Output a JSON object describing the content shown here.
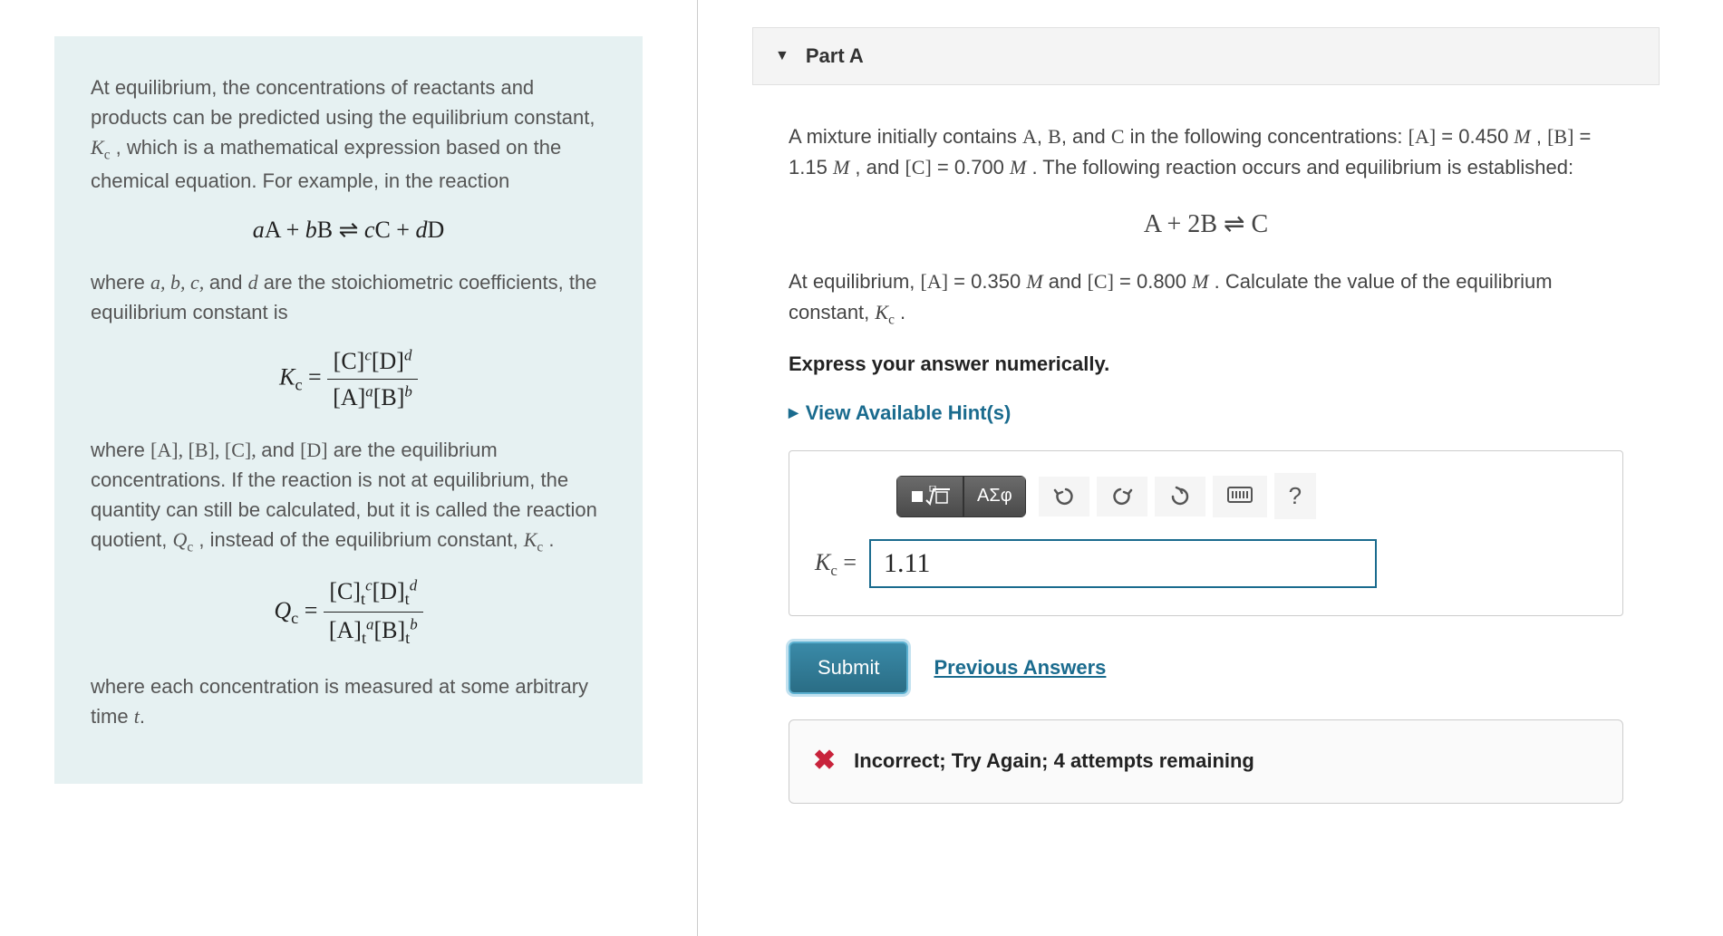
{
  "left": {
    "p1_a": "At equilibrium, the concentrations of reactants and products can be predicted using the equilibrium constant, ",
    "p1_b": ", which is a mathematical expression based on the chemical equation. For example, in the reaction",
    "p2_a": "where ",
    "p2_b": " are the stoichiometric coefficients, the equilibrium constant is",
    "p3_a": "where ",
    "p3_b": " are the equilibrium concentrations. If the reaction is not at equilibrium, the quantity can still be calculated, but it is called the reaction quotient, ",
    "p3_c": ", instead of the equilibrium constant, ",
    "p3_d": ".",
    "p4": "where each concentration is measured at some arbitrary time ",
    "var_Kc": "K",
    "var_Qc": "Q",
    "sub_c": "c",
    "list_abcd": "a, b, c, ",
    "and": "and ",
    "var_d": "d",
    "list_ABCD_a": "[A], [B], [C], ",
    "list_ABCD_d": "[D]",
    "var_t": "t",
    "eq1_html": "<span class='math-it'>a</span><span class='math-rm'>A</span> + <span class='math-it'>b</span><span class='math-rm'>B</span> &#8652; <span class='math-it'>c</span><span class='math-rm'>C</span> + <span class='math-it'>d</span><span class='math-rm'>D</span>"
  },
  "right": {
    "part_label": "Part A",
    "prob_a": "A mixture initially contains ",
    "prob_b": ", and ",
    "prob_c": " in the following concentrations: ",
    "valA": " = 0.450 ",
    "valB": " = 1.15 ",
    "valC": " = 0.700 ",
    "prob_d": ". The following reaction occurs and equilibrium is established:",
    "eq_center": "A + 2B &#8652; C",
    "prob2_a": "At equilibrium, ",
    "eqA": " = 0.350 ",
    "and2": " and ",
    "eqC": " = 0.800 ",
    "prob2_b": ". Calculate the value of the equilibrium constant, ",
    "instruction": "Express your answer numerically.",
    "hints": "View Available Hint(s)",
    "greek_btn": "ΑΣφ",
    "answer_value": "1.11",
    "submit": "Submit",
    "prev_answers": "Previous Answers",
    "feedback": "Incorrect; Try Again; 4 attempts remaining",
    "M": "M",
    "comma": ", ",
    "period": "."
  }
}
